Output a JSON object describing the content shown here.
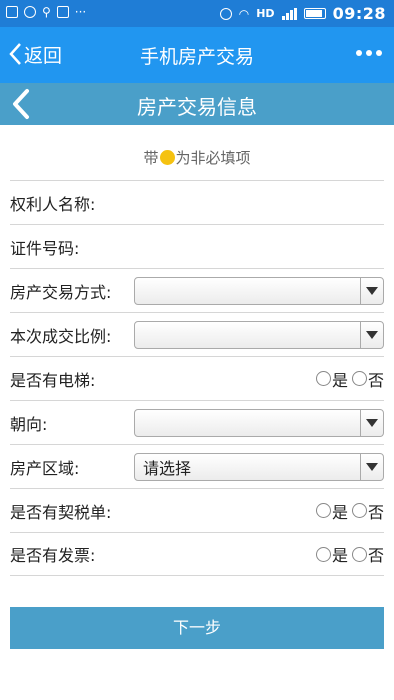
{
  "status_bar": {
    "time": "09:28",
    "network": "HD",
    "icons": [
      "image-icon",
      "chat-icon",
      "person-icon",
      "edit-icon",
      "more-dots-icon",
      "alarm-icon",
      "wifi-icon",
      "signal-icon",
      "battery-icon"
    ]
  },
  "navbar": {
    "back_label": "返回",
    "title": "手机房产交易"
  },
  "page": {
    "title": "房产交易信息"
  },
  "note": {
    "prefix": "带",
    "suffix": "为非必填项"
  },
  "form": {
    "rows": [
      {
        "label": "权利人名称:",
        "type": "text"
      },
      {
        "label": "证件号码:",
        "type": "text"
      },
      {
        "label": "房产交易方式:",
        "type": "select",
        "value": ""
      },
      {
        "label": "本次成交比例:",
        "type": "select",
        "value": ""
      },
      {
        "label": "是否有电梯:",
        "type": "radio",
        "options": [
          "是",
          "否"
        ]
      },
      {
        "label": "朝向:",
        "type": "select",
        "value": ""
      },
      {
        "label": "房产区域:",
        "type": "select",
        "value": "请选择"
      },
      {
        "label": "是否有契税单:",
        "type": "radio",
        "options": [
          "是",
          "否"
        ]
      },
      {
        "label": "是否有发票:",
        "type": "radio",
        "options": [
          "是",
          "否"
        ]
      }
    ]
  },
  "next_button": {
    "label": "下一步"
  },
  "colors": {
    "status_bar": "#1f7dd6",
    "navbar": "#2196f0",
    "page_header": "#4a9fc9",
    "optional_dot": "#f5c211",
    "button": "#4a9fc9"
  }
}
